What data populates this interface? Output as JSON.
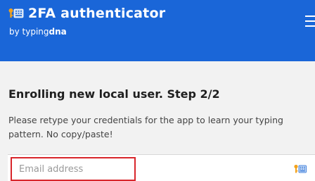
{
  "header": {
    "title": "2FA authenticator",
    "by_prefix": "by typing",
    "by_brand": "dna",
    "menu_icon": "hamburger-menu-icon",
    "logo_icon": "key-keypad-icon",
    "background_color": "#1a66d8"
  },
  "main": {
    "title": "Enrolling new local user. Step 2/2",
    "description": "Please retype your credentials for the app to learn your typing pattern. No copy/paste!",
    "email_input": {
      "placeholder": "Email address",
      "value": "",
      "highlight_color": "#d8262b",
      "trailing_icon": "key-keypad-icon"
    }
  }
}
